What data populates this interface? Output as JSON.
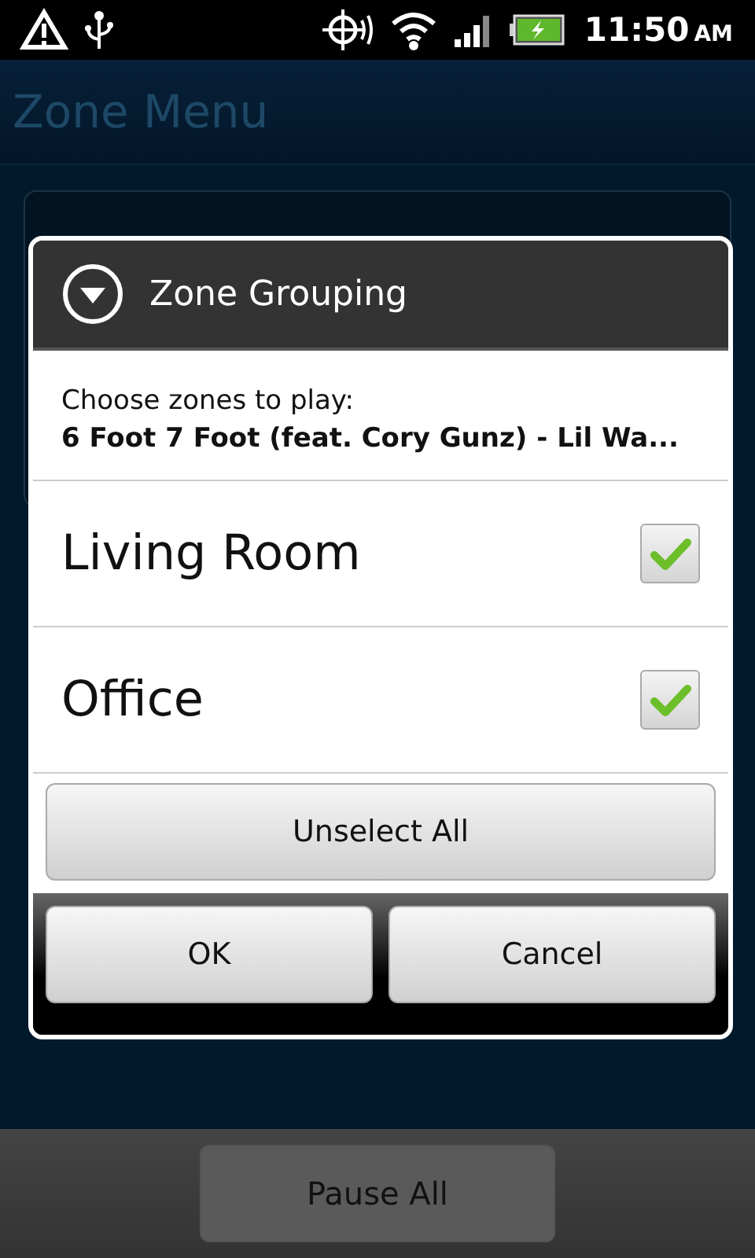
{
  "status_bar": {
    "time": "11:50",
    "ampm": "AM"
  },
  "app_bar": {
    "title": "Zone Menu"
  },
  "bottom_bar": {
    "button": "Pause All"
  },
  "dialog": {
    "title": "Zone Grouping",
    "prompt": "Choose zones to play:",
    "track": "6 Foot 7 Foot (feat. Cory Gunz) - Lil Wa...",
    "zones": [
      {
        "name": "Living Room",
        "checked": true
      },
      {
        "name": "Office",
        "checked": true
      }
    ],
    "unselect_button": "Unselect All",
    "buttons": [
      "OK",
      "Cancel"
    ]
  }
}
